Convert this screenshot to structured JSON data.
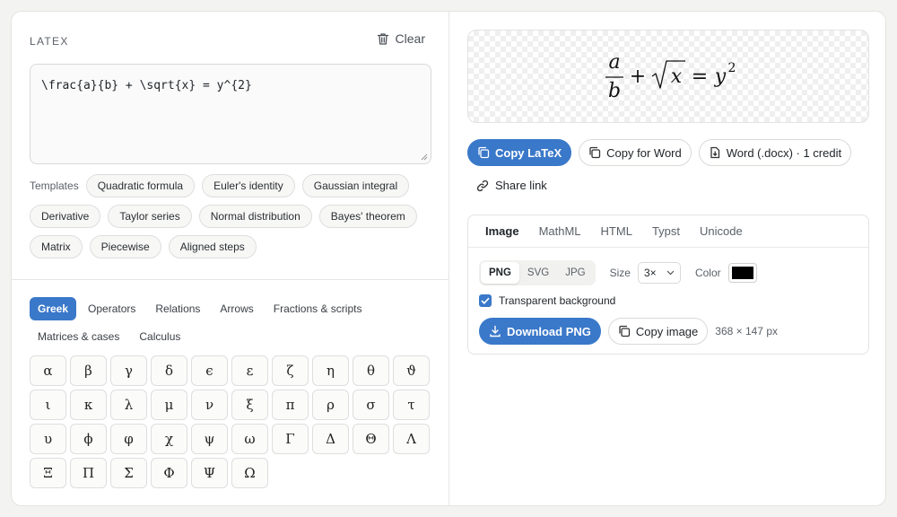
{
  "editor": {
    "label": "LATEX",
    "clear_label": "Clear",
    "value": "\\frac{a}{b} + \\sqrt{x} = y^{2}"
  },
  "templates": {
    "label": "Templates",
    "row1": [
      "Quadratic formula",
      "Euler's identity",
      "Gaussian integral"
    ],
    "row2": [
      "Derivative",
      "Taylor series",
      "Normal distribution",
      "Bayes' theorem"
    ],
    "row3": [
      "Matrix",
      "Piecewise",
      "Aligned steps"
    ]
  },
  "symbol_tabs": [
    "Greek",
    "Operators",
    "Relations",
    "Arrows",
    "Fractions & scripts",
    "Matrices & cases",
    "Calculus"
  ],
  "symbol_tabs_active": "Greek",
  "symbols": [
    "α",
    "β",
    "γ",
    "δ",
    "ϵ",
    "ε",
    "ζ",
    "η",
    "θ",
    "ϑ",
    "ι",
    "κ",
    "λ",
    "μ",
    "ν",
    "ξ",
    "π",
    "ρ",
    "σ",
    "τ",
    "υ",
    "ϕ",
    "φ",
    "χ",
    "ψ",
    "ω",
    "Γ",
    "Δ",
    "Θ",
    "Λ",
    "Ξ",
    "Π",
    "Σ",
    "Φ",
    "Ψ",
    "Ω"
  ],
  "preview": {
    "num": "a",
    "den": "b",
    "plus": "+",
    "radicand": "x",
    "eq": "=",
    "base": "y",
    "exp": "2"
  },
  "actions": {
    "copy_latex": "Copy LaTeX",
    "copy_word": "Copy for Word",
    "word_docx": "Word (.docx) · 1 credit",
    "share_link": "Share link"
  },
  "export": {
    "tabs": [
      "Image",
      "MathML",
      "HTML",
      "Typst",
      "Unicode"
    ],
    "active_tab": "Image",
    "formats": [
      "PNG",
      "SVG",
      "JPG"
    ],
    "active_format": "PNG",
    "size_label": "Size",
    "size_value": "3×",
    "color_label": "Color",
    "color_value": "#000000",
    "transparent_label": "Transparent background",
    "transparent_checked": true,
    "download_label": "Download PNG",
    "copy_image_label": "Copy image",
    "dimensions": "368 × 147 px"
  },
  "colors": {
    "accent": "#3a78c9"
  }
}
